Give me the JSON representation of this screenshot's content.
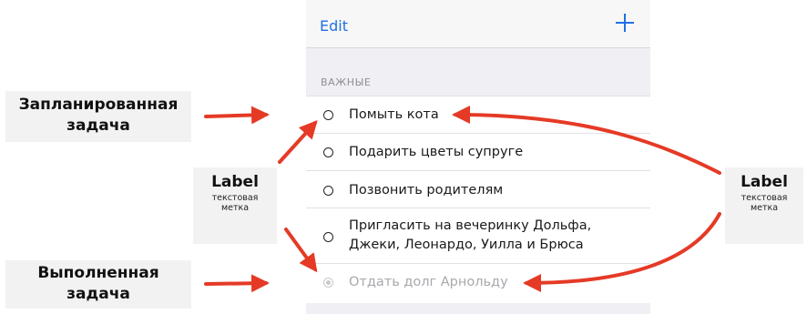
{
  "navbar": {
    "edit_label": "Edit",
    "add_icon": "plus-icon"
  },
  "section": {
    "header": "ВАЖНЫЕ"
  },
  "tasks": [
    {
      "title": "Помыть кота",
      "done": false
    },
    {
      "title": "Подарить цветы супруге",
      "done": false
    },
    {
      "title": "Позвонить родителям",
      "done": false
    },
    {
      "title_line1": "Пригласить на вечеринку Дольфа,",
      "title_line2": "Джеки, Леонардо, Уилла и Брюса",
      "done": false
    },
    {
      "title": "Отдать долг Арнольду",
      "done": true
    }
  ],
  "annotations": {
    "planned": {
      "line1": "Запланированная",
      "line2": "задача"
    },
    "completed": {
      "line1": "Выполненная",
      "line2": "задача"
    },
    "label_left": {
      "title": "Label",
      "sub1": "текстовая",
      "sub2": "метка"
    },
    "label_right": {
      "title": "Label",
      "sub1": "текстовая",
      "sub2": "метка"
    }
  },
  "colors": {
    "accent": "#1f6fe5",
    "arrow": "#e53a26",
    "section_bg": "#efeff4",
    "callout_bg": "#f2f2f2"
  }
}
